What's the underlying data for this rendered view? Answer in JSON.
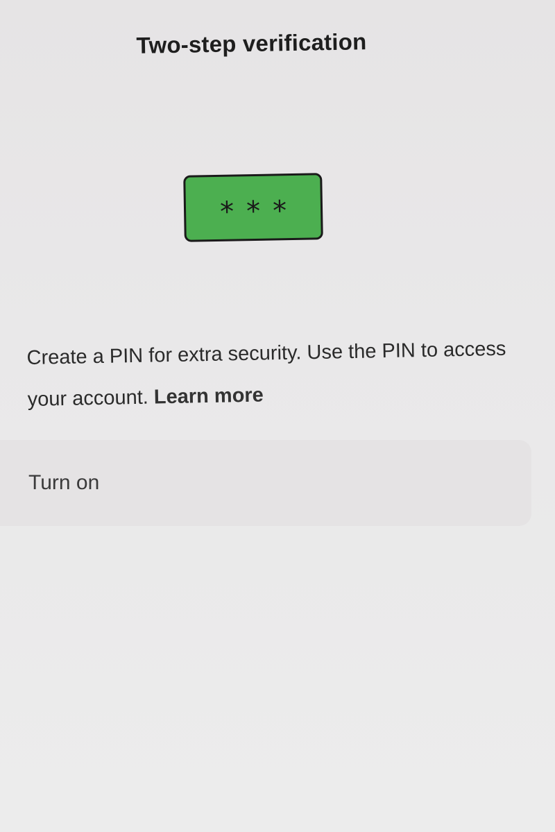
{
  "header": {
    "title": "Two-step verification"
  },
  "illustration": {
    "icon": "pin-asterisks-icon",
    "glyphs": [
      "*",
      "*",
      "*"
    ],
    "fill_color": "#4caf50",
    "border_color": "#1a1a1a"
  },
  "body": {
    "description": "Create a PIN for extra security. Use the PIN to access your account.",
    "learn_more_label": "Learn more"
  },
  "actions": {
    "turn_on_label": "Turn on"
  }
}
